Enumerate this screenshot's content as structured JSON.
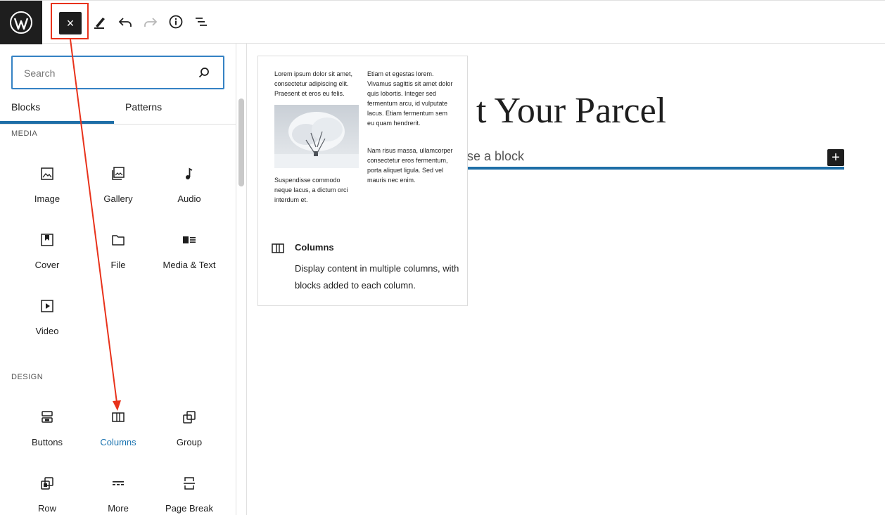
{
  "toolbar": {
    "close_label": "×"
  },
  "sidebar": {
    "search_placeholder": "Search",
    "tabs": [
      "Blocks",
      "Patterns"
    ],
    "categories": [
      {
        "name": "MEDIA",
        "blocks": [
          "Image",
          "Gallery",
          "Audio",
          "Cover",
          "File",
          "Media & Text",
          "Video"
        ]
      },
      {
        "name": "DESIGN",
        "blocks": [
          "Buttons",
          "Columns",
          "Group",
          "Row",
          "More",
          "Page Break"
        ]
      }
    ]
  },
  "canvas": {
    "title": "t Your Parcel",
    "appender_text": "se a block",
    "plus_label": "+"
  },
  "preview": {
    "col1_top": "Lorem ipsum dolor sit amet, consectetur adipiscing elit. Praesent et eros eu felis.",
    "col1_bottom": "Suspendisse commodo neque lacus, a dictum orci interdum et.",
    "col2_top": "Etiam et egestas lorem. Vivamus sagittis sit amet dolor quis lobortis. Integer sed fermentum arcu, id vulputate lacus. Etiam fermentum sem eu quam hendrerit.",
    "col2_bottom": "Nam risus massa, ullamcorper consectetur eros fermentum, porta aliquet ligula. Sed vel mauris nec enim.",
    "block_name": "Columns",
    "block_description": "Display content in multiple columns, with blocks added to each column."
  },
  "colors": {
    "accent": "#1e6ea7",
    "highlight": "#e8321b",
    "dark": "#1e1e1e"
  }
}
